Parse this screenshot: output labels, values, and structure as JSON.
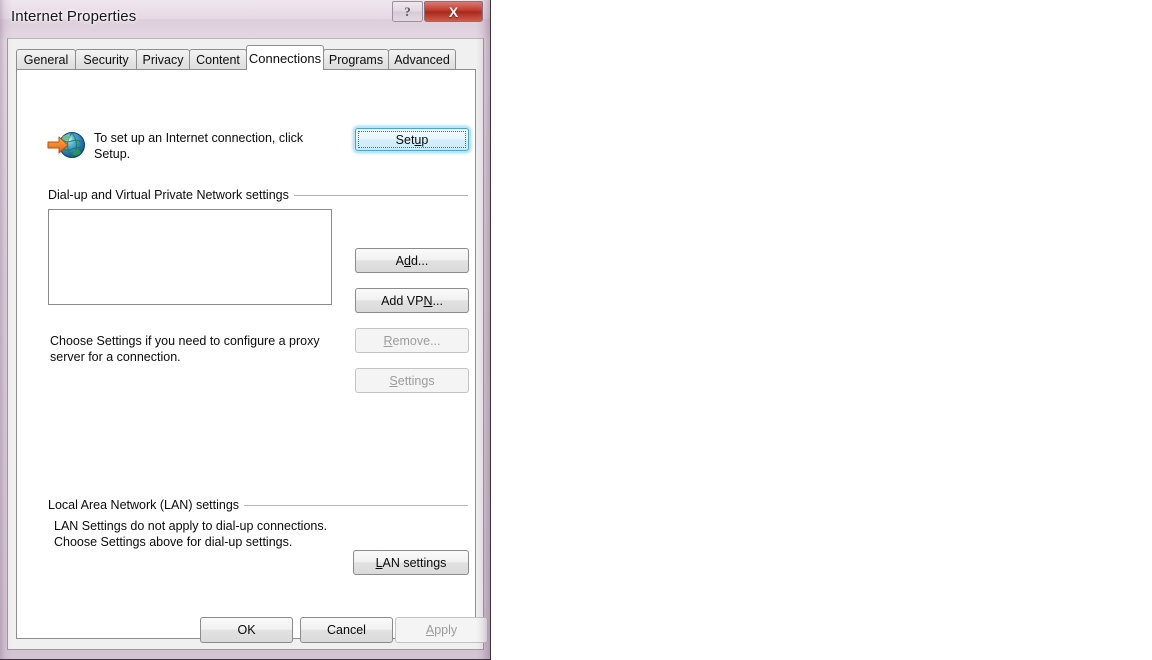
{
  "window": {
    "title": "Internet Properties",
    "help_label": "?",
    "close_label": "X"
  },
  "tabs": [
    {
      "label": "General",
      "name": "tab-general",
      "active": false
    },
    {
      "label": "Security",
      "name": "tab-security",
      "active": false
    },
    {
      "label": "Privacy",
      "name": "tab-privacy",
      "active": false
    },
    {
      "label": "Content",
      "name": "tab-content",
      "active": false
    },
    {
      "label": "Connections",
      "name": "tab-connections",
      "active": true
    },
    {
      "label": "Programs",
      "name": "tab-programs",
      "active": false
    },
    {
      "label": "Advanced",
      "name": "tab-advanced",
      "active": false
    }
  ],
  "setup": {
    "description": "To set up an Internet connection, click Setup.",
    "button_label_before": "Set",
    "button_label_accel": "u",
    "button_label_after": "p",
    "icon": "globe-with-arrow-icon"
  },
  "dialup_group": {
    "label": "Dial-up and Virtual Private Network settings",
    "list_items": [],
    "buttons": [
      {
        "name": "add-button",
        "before": "A",
        "accel": "d",
        "after": "d...",
        "disabled": false
      },
      {
        "name": "add-vpn-button",
        "before": "Add VP",
        "accel": "N",
        "after": "...",
        "disabled": false
      },
      {
        "name": "remove-button",
        "before": "",
        "accel": "R",
        "after": "emove...",
        "disabled": true
      },
      {
        "name": "settings-button",
        "before": "",
        "accel": "S",
        "after": "ettings",
        "disabled": true
      }
    ],
    "proxy_hint": "Choose Settings if you need to configure a proxy server for a connection."
  },
  "lan_group": {
    "label": "Local Area Network (LAN) settings",
    "hint": "LAN Settings do not apply to dial-up connections. Choose Settings above for dial-up settings.",
    "button": {
      "before": "",
      "accel": "L",
      "after": "AN settings"
    }
  },
  "footer": {
    "ok_label": "OK",
    "cancel_label": "Cancel",
    "apply_accel": "A",
    "apply_after": "pply",
    "apply_disabled": true
  },
  "colors": {
    "titlebar_tint": "#e6d9e5",
    "close_red": "#c0392b",
    "focus_blue": "#4aa5d4",
    "panel_bg": "#f0f0f0",
    "page_bg": "#ffffff",
    "disabled_text": "#9c9c9c"
  }
}
